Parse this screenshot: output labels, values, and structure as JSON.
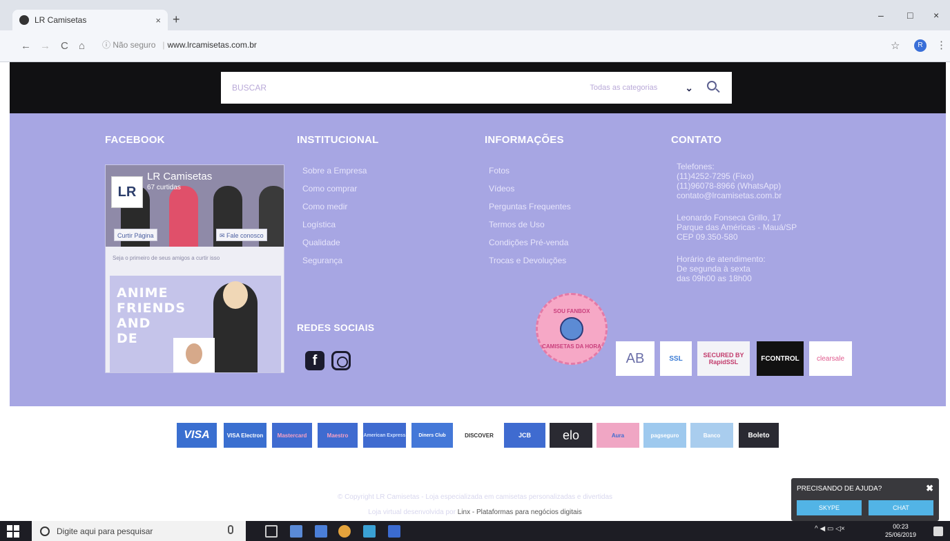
{
  "browser": {
    "tab_title": "LR Camisetas",
    "tab_close": "×",
    "new_tab": "+",
    "window_controls": [
      "–",
      "□",
      "×"
    ],
    "nav_icons": [
      "←",
      "→",
      "C",
      "⌂"
    ],
    "security": "ⓘ Não seguro",
    "separator": "|",
    "url": "www.lrcamisetas.com.br",
    "star": "☆",
    "profile_initial": "R",
    "menu": "⋮"
  },
  "header": {
    "search_placeholder": "BUSCAR",
    "category_select": "Todas as categorias",
    "chevron": "⌄"
  },
  "facebook": {
    "heading": "FACEBOOK",
    "page_name": "LR Camisetas",
    "likes": "67 curtidas",
    "logo": "LR",
    "like_button": "Curtir Página",
    "contact_button": "✉ Fale conosco",
    "friends_text": "Seja o primeiro de seus amigos a curtir isso",
    "post_text": [
      "ANIME",
      "FRIENDS",
      "AND",
      "DE"
    ]
  },
  "institucional": {
    "heading": "INSTITUCIONAL",
    "links": [
      "Sobre a Empresa",
      "Como comprar",
      "Como medir",
      "Logística",
      "Qualidade",
      "Segurança"
    ]
  },
  "informacoes": {
    "heading": "INFORMAÇÕES",
    "links": [
      "Fotos",
      "Vídeos",
      "Perguntas Frequentes",
      "Termos de Uso",
      "Condições Pré-venda",
      "Trocas e Devoluções"
    ]
  },
  "contato": {
    "heading": "CONTATO",
    "lines": [
      "Telefones:",
      "(11)4252-7295 (Fixo)",
      "(11)96078-8966 (WhatsApp)",
      "contato@lrcamisetas.com.br",
      "",
      "Leonardo Fonseca Grillo, 17",
      "Parque das Américas - Mauá/SP",
      "CEP 09.350-580",
      "",
      "Horário de atendimento:",
      "De segunda à sexta",
      "das 09h00 as 18h00"
    ]
  },
  "social": {
    "heading": "REDES SOCIAIS",
    "facebook_glyph": "f"
  },
  "seals": {
    "round_top": "SOU FANBOX",
    "round_bottom": "CAMISETAS DA HORA",
    "items": [
      "AB",
      "SSL",
      "SECURED BY RapidSSL",
      "FCONTROL",
      "clearsale"
    ]
  },
  "payments": [
    "VISA",
    "VISA Electron",
    "Mastercard",
    "Maestro",
    "American Express",
    "Diners Club",
    "DISCOVER",
    "JCB",
    "elo",
    "Aura",
    "pagseguro",
    "Banco",
    "Boleto"
  ],
  "footer": {
    "copyright": "© Copyright LR Camisetas - Loja especializada em camisetas personalizadas e divertidas",
    "platform_prefix": "Loja virtual desenvolvida por",
    "platform_link": "Linx - Plataformas para negócios digitais"
  },
  "help": {
    "title": "PRECISANDO DE AJUDA?",
    "close": "✖",
    "skype": "SKYPE",
    "chat": "CHAT"
  },
  "taskbar": {
    "search_placeholder": "Digite aqui para pesquisar",
    "time": "00:23",
    "date": "25/06/2019",
    "tray_icons": "^ ◀ ▭ ◁×"
  }
}
